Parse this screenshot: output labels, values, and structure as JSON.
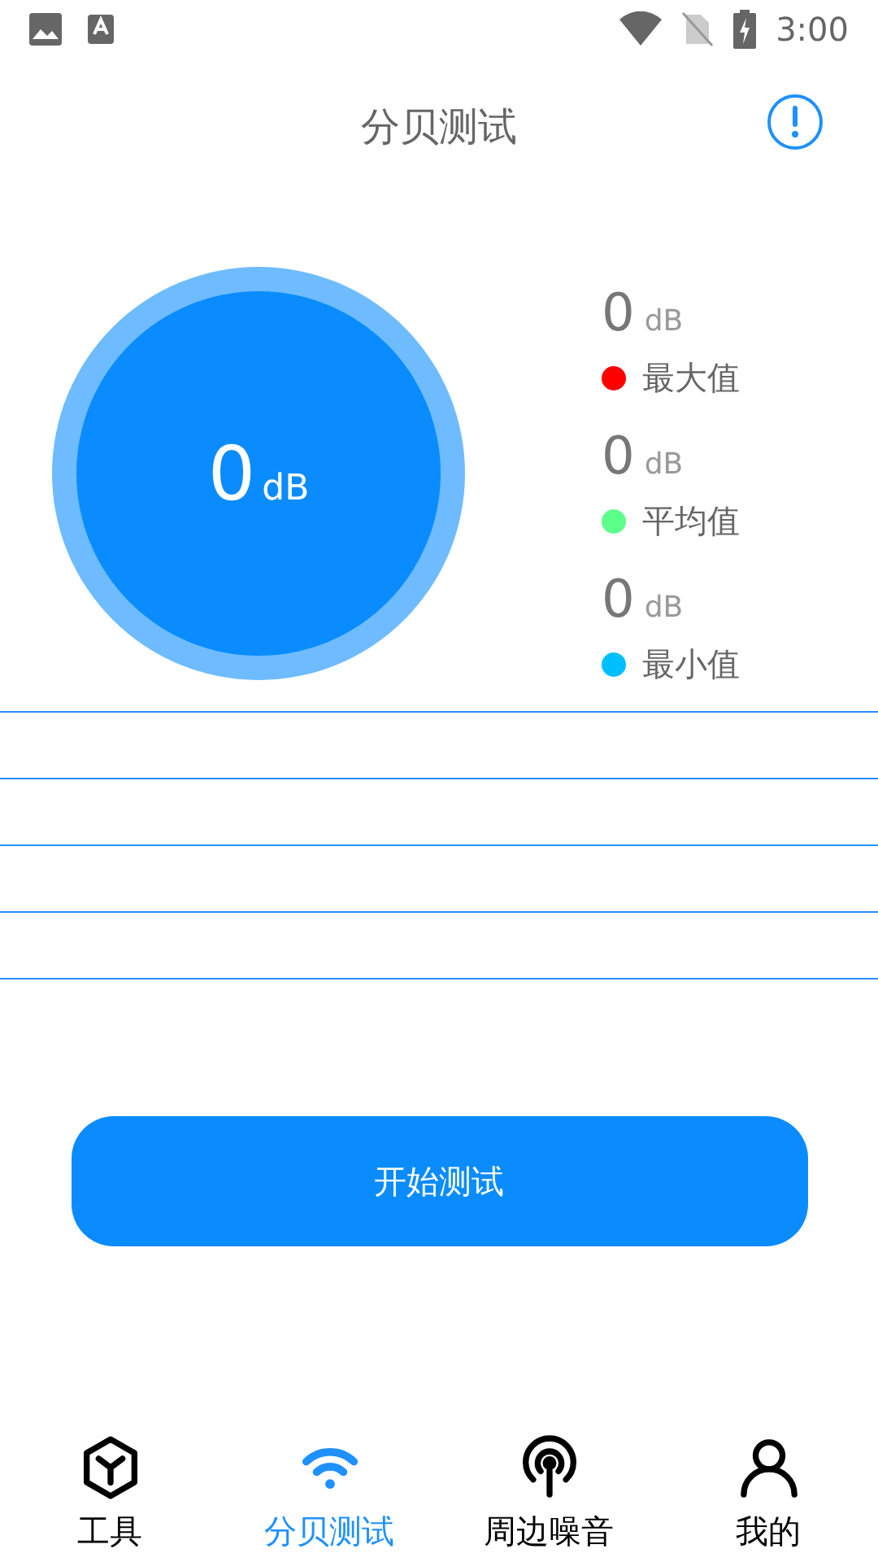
{
  "status_bar": {
    "time": "3:00"
  },
  "header": {
    "title": "分贝测试"
  },
  "gauge": {
    "value": "0",
    "unit": "dB"
  },
  "stats": [
    {
      "value": "0",
      "unit": "dB",
      "label": "最大值",
      "color": "#ff0000"
    },
    {
      "value": "0",
      "unit": "dB",
      "label": "平均值",
      "color": "#5cff8a"
    },
    {
      "value": "0",
      "unit": "dB",
      "label": "最小值",
      "color": "#00bfff"
    }
  ],
  "start_button": {
    "label": "开始测试"
  },
  "tabs": [
    {
      "kind": "cube",
      "label": "工具",
      "selected": false
    },
    {
      "kind": "wifi",
      "label": "分贝测试",
      "selected": true
    },
    {
      "kind": "broadcast",
      "label": "周边噪音",
      "selected": false
    },
    {
      "kind": "person",
      "label": "我的",
      "selected": false
    }
  ]
}
